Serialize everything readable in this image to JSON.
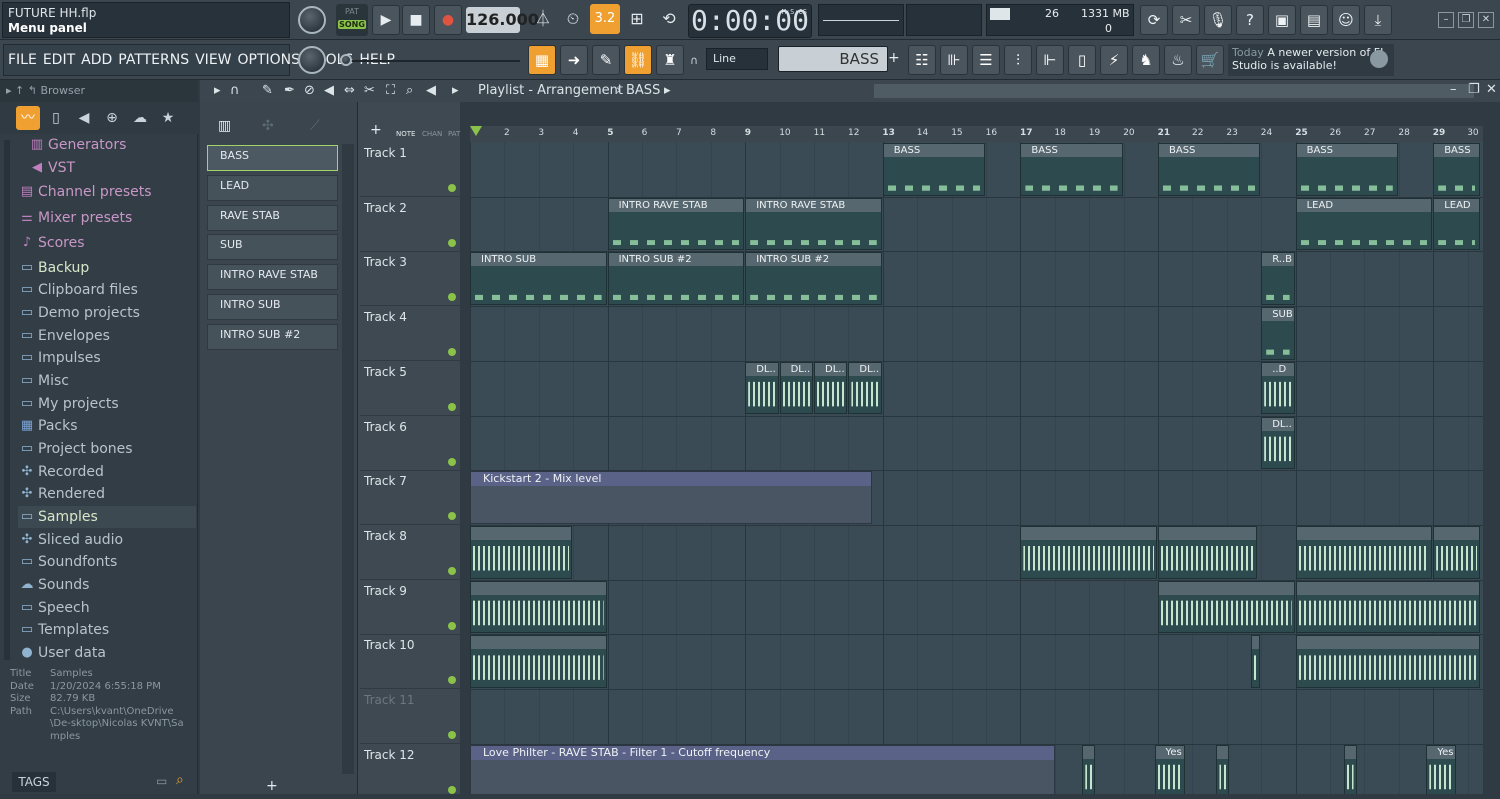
{
  "title_box": {
    "project": "FUTURE HH.flp",
    "hint": "Menu panel"
  },
  "transport": {
    "pat": "PAT",
    "song": "SONG",
    "play": "▶",
    "stop": "■",
    "record": "●",
    "tempo": "126.000",
    "snap": "3.2"
  },
  "time_display": {
    "value": "0:00:00",
    "format": "M:S:CS"
  },
  "cpu": {
    "cpu_value": "26",
    "memory": "1331 MB",
    "polyphony": "0"
  },
  "menu": [
    "FILE",
    "EDIT",
    "ADD",
    "PATTERNS",
    "VIEW",
    "OPTIONS",
    "TOOLS",
    "HELP"
  ],
  "toolbar2": {
    "line_mode": "Line",
    "pattern": "BASS",
    "add": "+"
  },
  "hint": {
    "today": "Today",
    "message": "A newer version of FL Studio is available!"
  },
  "browser": {
    "title": "Browser",
    "items": [
      {
        "label": "Generators",
        "icon": "generators-icon",
        "glyph": "▥"
      },
      {
        "label": "VST",
        "icon": "speaker-icon",
        "glyph": "◀"
      },
      {
        "label": "Channel presets",
        "icon": "channel-presets-icon",
        "glyph": "▤"
      },
      {
        "label": "Mixer presets",
        "icon": "mixer-presets-icon",
        "glyph": "⚌"
      },
      {
        "label": "Scores",
        "icon": "score-icon",
        "glyph": "♪"
      },
      {
        "label": "Backup",
        "icon": "folder-icon",
        "glyph": "▭"
      },
      {
        "label": "Clipboard files",
        "icon": "folder-icon",
        "glyph": "▭"
      },
      {
        "label": "Demo projects",
        "icon": "folder-icon",
        "glyph": "▭"
      },
      {
        "label": "Envelopes",
        "icon": "folder-icon",
        "glyph": "▭"
      },
      {
        "label": "Impulses",
        "icon": "folder-icon",
        "glyph": "▭"
      },
      {
        "label": "Misc",
        "icon": "folder-icon",
        "glyph": "▭"
      },
      {
        "label": "My projects",
        "icon": "folder-icon",
        "glyph": "▭"
      },
      {
        "label": "Packs",
        "icon": "packs-icon",
        "glyph": "▦"
      },
      {
        "label": "Project bones",
        "icon": "folder-icon",
        "glyph": "▭"
      },
      {
        "label": "Recorded",
        "icon": "recorded-icon",
        "glyph": "✣"
      },
      {
        "label": "Rendered",
        "icon": "rendered-icon",
        "glyph": "✣"
      },
      {
        "label": "Samples",
        "icon": "folder-icon",
        "glyph": "▭"
      },
      {
        "label": "Sliced audio",
        "icon": "sliced-audio-icon",
        "glyph": "✣"
      },
      {
        "label": "Soundfonts",
        "icon": "folder-icon",
        "glyph": "▭"
      },
      {
        "label": "Sounds",
        "icon": "cloud-icon",
        "glyph": "☁"
      },
      {
        "label": "Speech",
        "icon": "folder-icon",
        "glyph": "▭"
      },
      {
        "label": "Templates",
        "icon": "folder-icon",
        "glyph": "▭"
      },
      {
        "label": "User data",
        "icon": "user-icon",
        "glyph": "●"
      }
    ],
    "info": {
      "title_k": "Title",
      "title_v": "Samples",
      "date_k": "Date",
      "date_v": "1/20/2024 6:55:18 PM",
      "size_k": "Size",
      "size_v": "82.79 KB",
      "path_k": "Path",
      "path_v": "C:\\Users\\kvant\\OneDrive\\De-sktop\\Nicolas KVNT\\Samples"
    },
    "tags": "TAGS"
  },
  "channels": [
    "BASS",
    "LEAD",
    "RAVE STAB",
    "SUB",
    "INTRO RAVE STAB",
    "INTRO SUB",
    "INTRO SUB #2"
  ],
  "playlist": {
    "title": "Playlist - Arrangement",
    "pattern": "BASS",
    "tabs": [
      "NOTE",
      "CHAN",
      "PAT"
    ],
    "tracks": [
      "Track 1",
      "Track 2",
      "Track 3",
      "Track 4",
      "Track 5",
      "Track 6",
      "Track 7",
      "Track 8",
      "Track 9",
      "Track 10",
      "Track 11",
      "Track 12"
    ],
    "bars": [
      "2",
      "3",
      "4",
      "5",
      "6",
      "7",
      "8",
      "9",
      "10",
      "11",
      "12",
      "13",
      "14",
      "15",
      "16",
      "17",
      "18",
      "19",
      "20",
      "21",
      "22",
      "23",
      "24",
      "25",
      "26",
      "27",
      "28",
      "29",
      "30"
    ],
    "clip_labels": {
      "bass": "BASS",
      "lead": "LEAD",
      "intro_rave": "INTRO RAVE STAB",
      "intro_sub": "INTRO SUB",
      "intro_sub2": "INTRO SUB #2",
      "rb": "R..B",
      "sub": "SUB",
      "dl": "DL..",
      "d": "..D",
      "auto1": "Kickstart 2 - Mix level",
      "auto2": "Love Philter - RAVE STAB - Filter 1 - Cutoff frequency",
      "yes": "Yes"
    }
  }
}
